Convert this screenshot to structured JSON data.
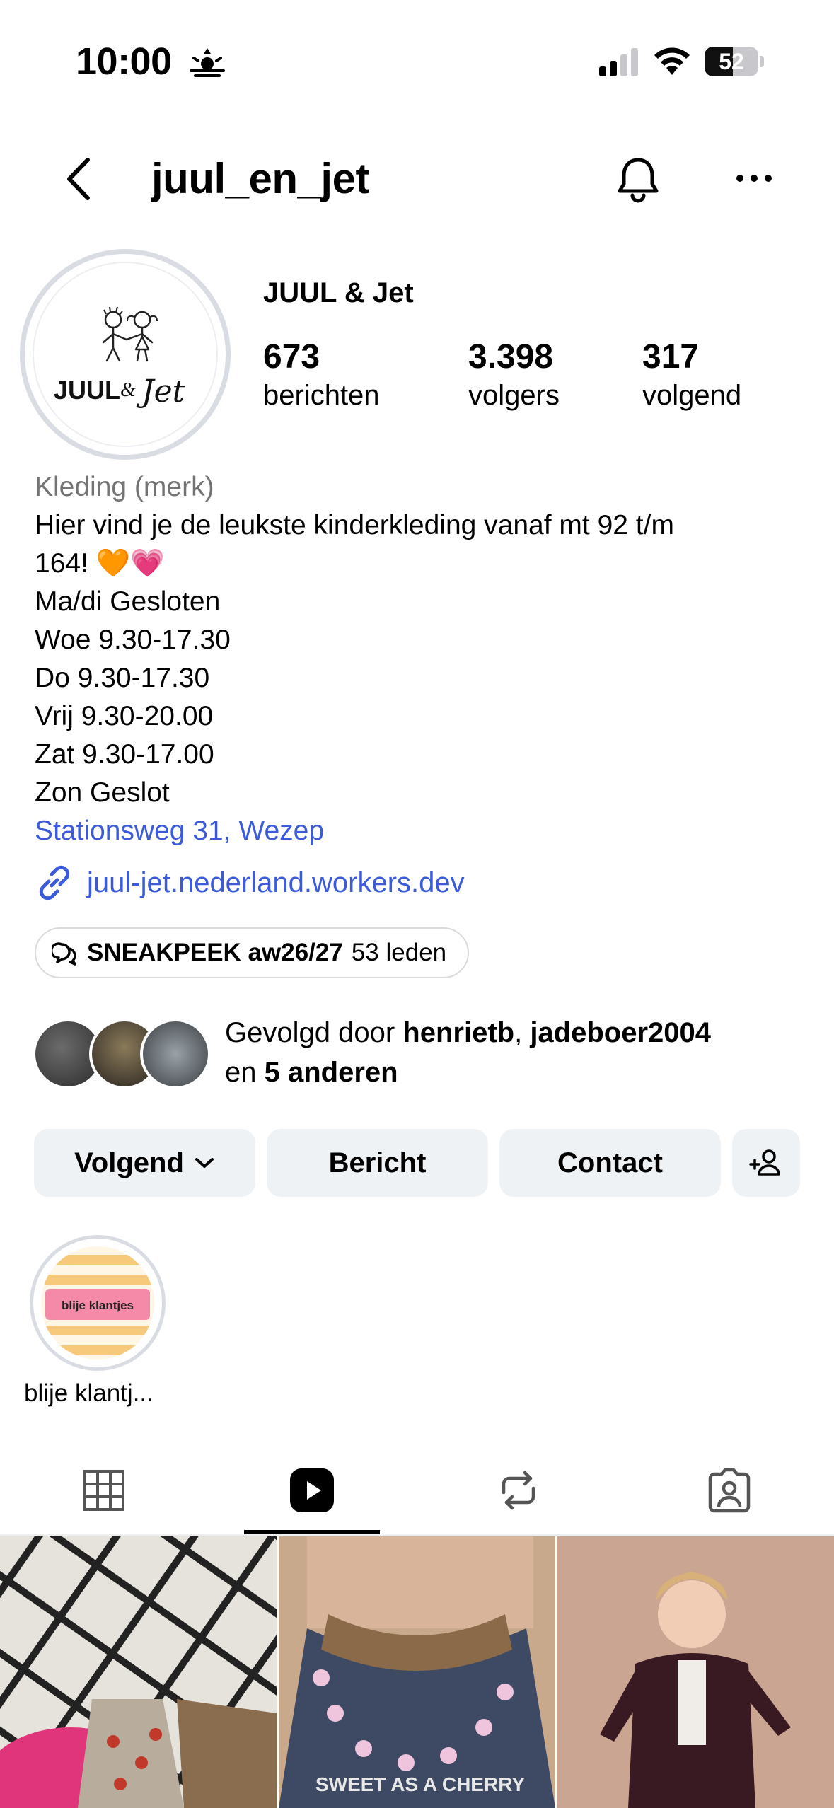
{
  "status_bar": {
    "time": "10:00",
    "battery_percent": "52",
    "battery_level": 0.52,
    "icons": [
      "sunrise-icon",
      "cellular-signal-icon",
      "wifi-icon",
      "battery-icon"
    ]
  },
  "header": {
    "username": "juul_en_jet",
    "icons": [
      "chevron-left-icon",
      "bell-icon",
      "more-horizontal-icon"
    ]
  },
  "profile": {
    "display_name": "JUUL & Jet",
    "logo_text": {
      "brand": "JUUL",
      "amp": "&",
      "brand2": "Jet"
    },
    "stats": [
      {
        "value": "673",
        "label": "berichten"
      },
      {
        "value": "3.398",
        "label": "volgers"
      },
      {
        "value": "317",
        "label": "volgend"
      }
    ]
  },
  "bio": {
    "category": "Kleding (merk)",
    "lines": [
      "Hier vind je de leukste kinderkleding vanaf mt 92 t/m",
      "164! 🧡💗",
      "Ma/di Gesloten",
      "Woe 9.30-17.30",
      "Do 9.30-17.30",
      "Vrij 9.30-20.00",
      "Zat 9.30-17.00",
      "Zon Geslot"
    ],
    "address": "Stationsweg 31, Wezep",
    "link": "juul-jet.nederland.workers.dev"
  },
  "channel": {
    "name": "SNEAKPEEK aw26/27",
    "members": "53 leden"
  },
  "followed_by": {
    "prefix": "Gevolgd door ",
    "user1": "henrietb",
    "sep": ", ",
    "user2": "jadeboer2004",
    "middle": "en ",
    "others": "5 anderen"
  },
  "buttons": {
    "following": "Volgend",
    "message": "Bericht",
    "contact": "Contact"
  },
  "highlights": [
    {
      "label": "blije klantj...",
      "image_text": "blije klantjes"
    }
  ],
  "tabs": [
    "grid-icon",
    "reels-icon",
    "reposts-icon",
    "tagged-icon"
  ],
  "grid": {
    "thumb2_text": "SWEET AS A CHERRY"
  },
  "colors": {
    "link_blue": "#3b5bdb",
    "muted_gray": "#737373",
    "button_bg": "#eff2f5"
  }
}
